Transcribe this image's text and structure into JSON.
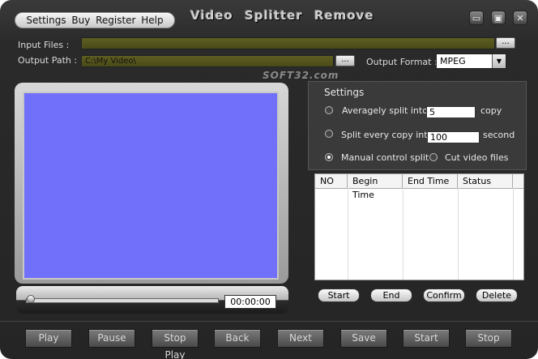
{
  "menu": [
    "Settings",
    "Buy",
    "Register",
    "Help"
  ],
  "title": "Video  Splitter  Remove",
  "window_controls": {
    "minimize": "▭",
    "maximize": "▣",
    "close": "✕"
  },
  "input_files": {
    "label": "Input Files :",
    "value": "",
    "browse": "..."
  },
  "output_path": {
    "label": "Output Path :",
    "value": "C:\\My Video\\",
    "browse": "..."
  },
  "output_format": {
    "label": "Output Format :",
    "selected": "MPEG",
    "arrow": "▼"
  },
  "watermark": "SOFT32.com",
  "player": {
    "timecode": "00:00:00",
    "video_color": "#7070fb"
  },
  "settings": {
    "title": "Settings",
    "opt1": {
      "label": "Averagely split into",
      "value": "5",
      "unit": "copy",
      "checked": false
    },
    "opt2": {
      "label": "Split every copy into",
      "value": "100",
      "unit": "second",
      "checked": false
    },
    "opt3": {
      "label": "Manual control split",
      "checked": true
    },
    "opt4": {
      "label": "Cut video files",
      "checked": false
    }
  },
  "table": {
    "columns": [
      "NO",
      "Begin Time",
      "End Time",
      "Status"
    ],
    "rows": []
  },
  "panel_buttons": [
    "Start",
    "End",
    "Confirm",
    "Delete"
  ],
  "bottom_buttons": [
    "Play",
    "Pause",
    "Stop Play",
    "Back",
    "Next",
    "Save",
    "Start",
    "Stop"
  ]
}
